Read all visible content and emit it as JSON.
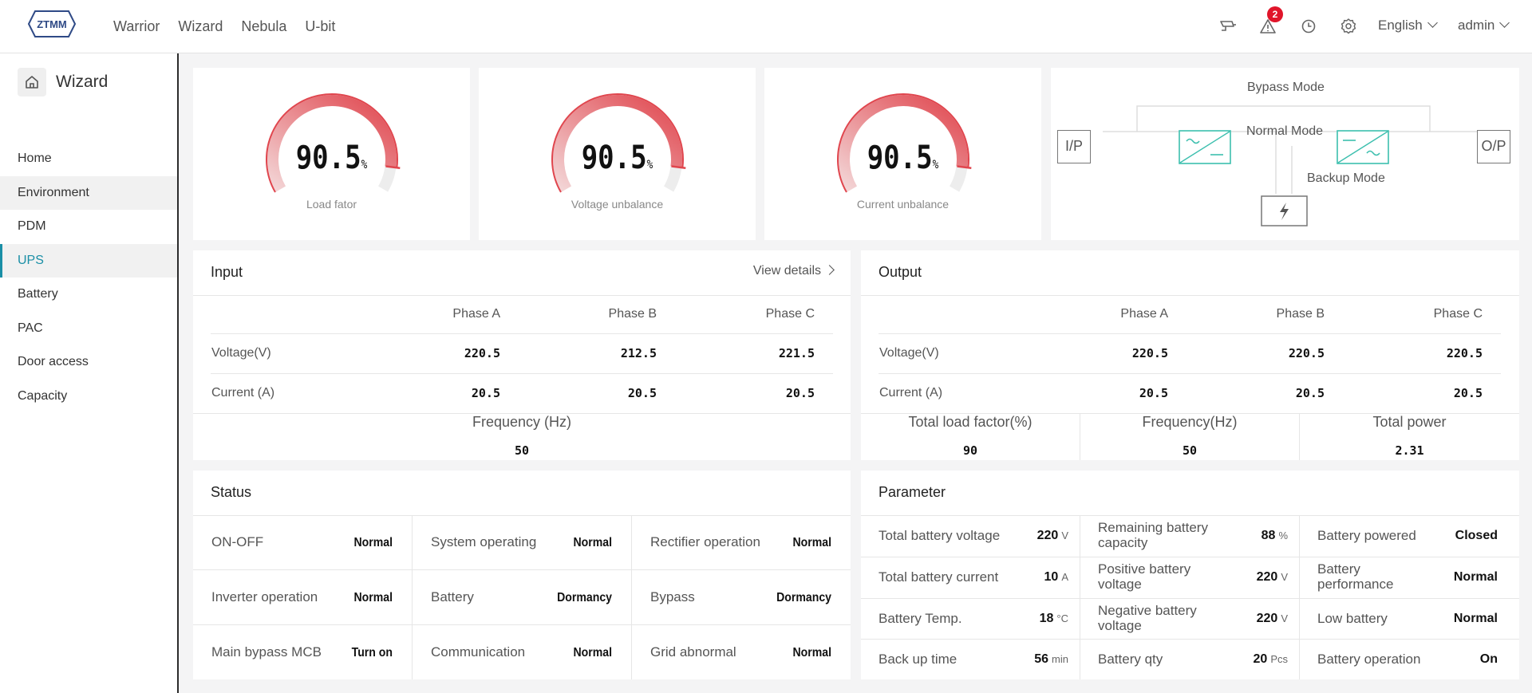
{
  "topnav": [
    "Warrior",
    "Wizard",
    "Nebula",
    "U-bit"
  ],
  "logo_text": "ZTMM",
  "header": {
    "alarm_count": "2",
    "language": "English",
    "user": "admin"
  },
  "sidebar": {
    "title": "Wizard",
    "items": [
      "Home",
      "Environment",
      "PDM",
      "UPS",
      "Battery",
      "PAC",
      "Door access",
      "Capacity"
    ],
    "active": "UPS"
  },
  "gauges": [
    {
      "value": "90.5",
      "unit": "%",
      "label": "Load fator",
      "fraction": 0.905
    },
    {
      "value": "90.5",
      "unit": "%",
      "label": "Voltage unbalance",
      "fraction": 0.905
    },
    {
      "value": "90.5",
      "unit": "%",
      "label": "Current unbalance",
      "fraction": 0.905
    }
  ],
  "diagram": {
    "bypass": "Bypass Mode",
    "normal": "Normal Mode",
    "backup": "Backup Mode",
    "ip": "I/P",
    "op": "O/P"
  },
  "input": {
    "title": "Input",
    "view_details": "View details",
    "phases": [
      "Phase A",
      "Phase B",
      "Phase C"
    ],
    "rows": [
      {
        "label": "Voltage(V)",
        "values": [
          "220.5",
          "212.5",
          "221.5"
        ]
      },
      {
        "label": "Current (A)",
        "values": [
          "20.5",
          "20.5",
          "20.5"
        ]
      }
    ],
    "frequency_label": "Frequency (Hz)",
    "frequency_value": "50"
  },
  "output": {
    "title": "Output",
    "phases": [
      "Phase A",
      "Phase B",
      "Phase C"
    ],
    "rows": [
      {
        "label": "Voltage(V)",
        "values": [
          "220.5",
          "220.5",
          "220.5"
        ]
      },
      {
        "label": "Current (A)",
        "values": [
          "20.5",
          "20.5",
          "20.5"
        ]
      }
    ],
    "summary": [
      {
        "label": "Total load factor(%)",
        "value": "90"
      },
      {
        "label": "Frequency(Hz)",
        "value": "50"
      },
      {
        "label": "Total power",
        "value": "2.31"
      }
    ]
  },
  "status": {
    "title": "Status",
    "cells": [
      {
        "label": "ON-OFF",
        "value": "Normal"
      },
      {
        "label": "System operating",
        "value": "Normal"
      },
      {
        "label": "Rectifier operation",
        "value": "Normal"
      },
      {
        "label": "Inverter operation",
        "value": "Normal"
      },
      {
        "label": "Battery",
        "value": "Dormancy"
      },
      {
        "label": "Bypass",
        "value": "Dormancy"
      },
      {
        "label": "Main bypass MCB",
        "value": "Turn on"
      },
      {
        "label": "Communication",
        "value": "Normal"
      },
      {
        "label": "Grid abnormal",
        "value": "Normal"
      }
    ]
  },
  "parameter": {
    "title": "Parameter",
    "cells": [
      {
        "label": "Total battery voltage",
        "value": "220",
        "unit": "V"
      },
      {
        "label": "Remaining battery capacity",
        "value": "88",
        "unit": "%"
      },
      {
        "label": "Battery powered",
        "value": "Closed",
        "unit": ""
      },
      {
        "label": "Total battery current",
        "value": "10",
        "unit": "A"
      },
      {
        "label": "Positive battery voltage",
        "value": "220",
        "unit": "V"
      },
      {
        "label": "Battery performance",
        "value": "Normal",
        "unit": ""
      },
      {
        "label": "Battery Temp.",
        "value": "18",
        "unit": "°C"
      },
      {
        "label": "Negative battery voltage",
        "value": "220",
        "unit": "V"
      },
      {
        "label": "Low battery",
        "value": "Normal",
        "unit": ""
      },
      {
        "label": "Back up time",
        "value": "56",
        "unit": "min"
      },
      {
        "label": "Battery qty",
        "value": "20",
        "unit": "Pcs"
      },
      {
        "label": "Battery operation",
        "value": "On",
        "unit": ""
      }
    ]
  },
  "colors": {
    "accent": "#1a8fa6",
    "gauge": "#e0464e",
    "gauge_light": "#f3d6d7",
    "diagram": "#3cbfae",
    "alarm": "#e0152a"
  }
}
